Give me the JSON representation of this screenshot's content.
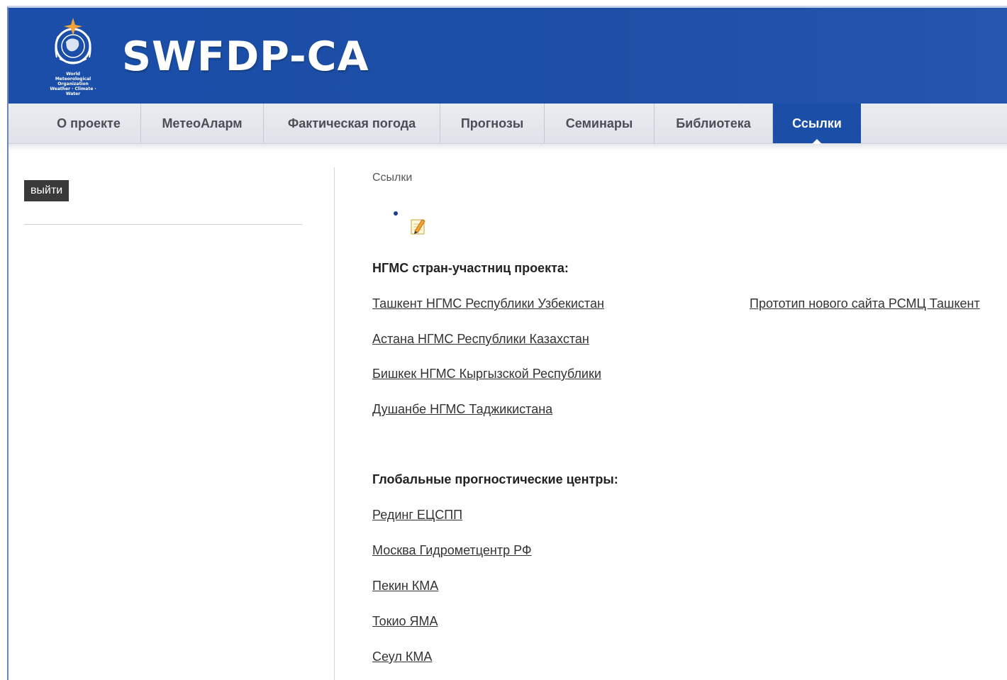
{
  "header": {
    "title": "SWFDP-CA",
    "logo_text": [
      "World",
      "Meteorological",
      "Organization",
      "Weather · Climate · Water"
    ],
    "brand_color": "#1b4fa7"
  },
  "nav": {
    "items": [
      {
        "label": "О проекте",
        "active": false
      },
      {
        "label": "МетеоАларм",
        "active": false
      },
      {
        "label": "Фактическая погода",
        "active": false
      },
      {
        "label": "Прогнозы",
        "active": false
      },
      {
        "label": "Семинары",
        "active": false
      },
      {
        "label": "Библиотека",
        "active": false
      },
      {
        "label": "Ссылки",
        "active": true
      }
    ]
  },
  "sidebar": {
    "logout_label": "выйти"
  },
  "main": {
    "breadcrumb": "Ссылки",
    "edit_icon": "pencil-note-icon",
    "sections": [
      {
        "heading": "НГМС стран-участниц проекта:",
        "links": [
          "Ташкент НГМС Республики Узбекистан",
          "Астана НГМС Республики Казахстан",
          "Бишкек НГМС Кыргызской Республики",
          "Душанбе НГМС Таджикистана"
        ],
        "side_link": "Прототип нового сайта РСМЦ Ташкент"
      },
      {
        "heading": "Глобальные прогностические центры:",
        "links": [
          "Рединг ЕЦСПП",
          "Москва Гидрометцентр РФ",
          "Пекин КМА",
          "Токио ЯМА",
          "Сеул КМА"
        ]
      }
    ]
  }
}
